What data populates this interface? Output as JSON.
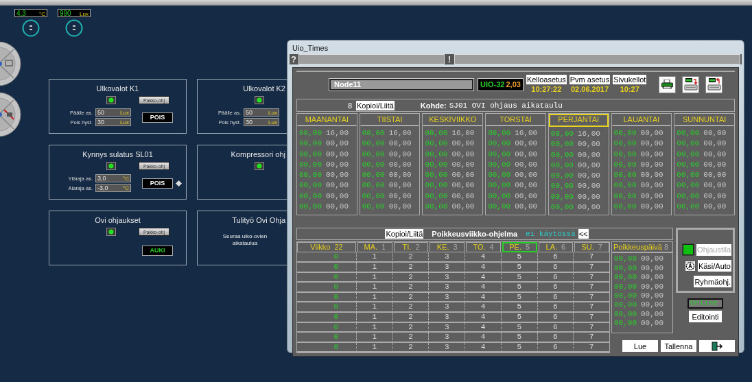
{
  "sensors": [
    {
      "value": "4,3",
      "unit": "°C"
    },
    {
      "value": "990",
      "unit": "Lux"
    }
  ],
  "panels": [
    {
      "title": "Ulkovalot K1",
      "indicator_on": true,
      "button": "Pakko-ohj",
      "rows": [
        {
          "label": "Päälle as.",
          "value": "50",
          "unit": "Lux"
        },
        {
          "label": "Pois hyst.",
          "value": "30",
          "unit": "Lux"
        }
      ],
      "status": "POIS",
      "status_on": false
    },
    {
      "title": "Ulkovalot K2",
      "indicator_on": true,
      "rows": [
        {
          "label": "Päälle as.",
          "value": "50",
          "unit": "Lux"
        },
        {
          "label": "Pois hyst.",
          "value": "30",
          "unit": "Lux"
        }
      ]
    },
    {
      "title": "Kynnys sulatus SL01",
      "indicator_on": true,
      "button": "Pakko-ohj",
      "rows": [
        {
          "label": "Yläraja as.",
          "value": "3,0",
          "unit": "°C"
        },
        {
          "label": "Alaraja as.",
          "value": "-3,0",
          "unit": "°C"
        }
      ],
      "status": "POIS",
      "status_on": false,
      "marker": true
    },
    {
      "title": "Kompressori ohj",
      "indicator_on": true
    },
    {
      "title": "Ovi ohjaukset",
      "indicator_on": true,
      "button": "Pakko-ohj",
      "status": "AUKI",
      "status_on": true
    },
    {
      "title": "Tulityö Ovi Ohja",
      "note": "Seuraa ulko-ovien aikataulua"
    }
  ],
  "dialog": {
    "title": "Uio_Times",
    "help_mark": "?",
    "alert_mark": "!",
    "node": "Node11",
    "version_name": "UIO-32",
    "version_number": "2,03",
    "clocks": [
      {
        "label": "Kelloasetus",
        "value": "10:27:22"
      },
      {
        "label": "Pvm asetus",
        "value": "02.06.2017"
      },
      {
        "label": "Sivukellot",
        "value": "10:27"
      }
    ],
    "program_number": "8",
    "copy_button": "Kopioi/Liitä",
    "target_label": "Kohde:",
    "target": "SJ01 OVI ohjaus aikataulu",
    "days": [
      {
        "name": "MAANANTAI",
        "selected": false,
        "times": [
          {
            "on": "08,00",
            "off": "16,00"
          },
          {
            "on": "00,00",
            "off": "00,00"
          },
          {
            "on": "00,00",
            "off": "00,00"
          },
          {
            "on": "00,00",
            "off": "00,00"
          },
          {
            "on": "00,00",
            "off": "00,00"
          },
          {
            "on": "00,00",
            "off": "00,00"
          },
          {
            "on": "00,00",
            "off": "00,00"
          },
          {
            "on": "00,00",
            "off": "00,00"
          }
        ]
      },
      {
        "name": "TIISTAI",
        "selected": false,
        "times": [
          {
            "on": "08,00",
            "off": "16,00"
          },
          {
            "on": "00,00",
            "off": "00,00"
          },
          {
            "on": "00,00",
            "off": "00,00"
          },
          {
            "on": "00,00",
            "off": "00,00"
          },
          {
            "on": "00,00",
            "off": "00,00"
          },
          {
            "on": "00,00",
            "off": "00,00"
          },
          {
            "on": "00,00",
            "off": "00,00"
          },
          {
            "on": "00,00",
            "off": "00,00"
          }
        ]
      },
      {
        "name": "KESKIVIIKKO",
        "selected": false,
        "times": [
          {
            "on": "08,00",
            "off": "16,00"
          },
          {
            "on": "00,00",
            "off": "00,00"
          },
          {
            "on": "00,00",
            "off": "00,00"
          },
          {
            "on": "00,00",
            "off": "00,00"
          },
          {
            "on": "00,00",
            "off": "00,00"
          },
          {
            "on": "00,00",
            "off": "00,00"
          },
          {
            "on": "00,00",
            "off": "00,00"
          },
          {
            "on": "00,00",
            "off": "00,00"
          }
        ]
      },
      {
        "name": "TORSTAI",
        "selected": false,
        "times": [
          {
            "on": "08,00",
            "off": "16,00"
          },
          {
            "on": "00,00",
            "off": "00,00"
          },
          {
            "on": "00,00",
            "off": "00,00"
          },
          {
            "on": "00,00",
            "off": "00,00"
          },
          {
            "on": "00,00",
            "off": "00,00"
          },
          {
            "on": "00,00",
            "off": "00,00"
          },
          {
            "on": "00,00",
            "off": "00,00"
          },
          {
            "on": "00,00",
            "off": "00,00"
          }
        ]
      },
      {
        "name": "PERJANTAI",
        "selected": true,
        "times": [
          {
            "on": "08,00",
            "off": "16,00"
          },
          {
            "on": "00,00",
            "off": "00,00"
          },
          {
            "on": "00,00",
            "off": "00,00"
          },
          {
            "on": "00,00",
            "off": "00,00"
          },
          {
            "on": "00,00",
            "off": "00,00"
          },
          {
            "on": "00,00",
            "off": "00,00"
          },
          {
            "on": "00,00",
            "off": "00,00"
          },
          {
            "on": "00,00",
            "off": "00,00"
          }
        ]
      },
      {
        "name": "LAUANTAI",
        "selected": false,
        "times": [
          {
            "on": "00,00",
            "off": "00,00"
          },
          {
            "on": "00,00",
            "off": "00,00"
          },
          {
            "on": "00,00",
            "off": "00,00"
          },
          {
            "on": "00,00",
            "off": "00,00"
          },
          {
            "on": "00,00",
            "off": "00,00"
          },
          {
            "on": "00,00",
            "off": "00,00"
          },
          {
            "on": "00,00",
            "off": "00,00"
          },
          {
            "on": "00,00",
            "off": "00,00"
          }
        ]
      },
      {
        "name": "SUNNUNTAI",
        "selected": false,
        "times": [
          {
            "on": "00,00",
            "off": "00,00"
          },
          {
            "on": "00,00",
            "off": "00,00"
          },
          {
            "on": "00,00",
            "off": "00,00"
          },
          {
            "on": "00,00",
            "off": "00,00"
          },
          {
            "on": "00,00",
            "off": "00,00"
          },
          {
            "on": "00,00",
            "off": "00,00"
          },
          {
            "on": "00,00",
            "off": "00,00"
          },
          {
            "on": "00,00",
            "off": "00,00"
          }
        ]
      }
    ],
    "exception": {
      "copy_button": "Kopioi/Liitä",
      "title": "Poikkeusviikko-ohjelma",
      "status": "ei käytössä",
      "collapse_button": "<<",
      "week_label": "Viikko",
      "week": "22",
      "columns": [
        {
          "abbr": "MA.",
          "number": "1",
          "selected": false
        },
        {
          "abbr": "TI.",
          "number": "2",
          "selected": false
        },
        {
          "abbr": "KE.",
          "number": "3",
          "selected": false
        },
        {
          "abbr": "TO.",
          "number": "4",
          "selected": false
        },
        {
          "abbr": "PE.",
          "number": "5",
          "selected": true
        },
        {
          "abbr": "LA.",
          "number": "6",
          "selected": false
        },
        {
          "abbr": "SU.",
          "number": "7",
          "selected": false
        }
      ],
      "rows": [
        {
          "week": "0",
          "days": [
            "1",
            "2",
            "3",
            "4",
            "5",
            "6",
            "7"
          ]
        },
        {
          "week": "0",
          "days": [
            "1",
            "2",
            "3",
            "4",
            "5",
            "6",
            "7"
          ]
        },
        {
          "week": "0",
          "days": [
            "1",
            "2",
            "3",
            "4",
            "5",
            "6",
            "7"
          ]
        },
        {
          "week": "0",
          "days": [
            "1",
            "2",
            "3",
            "4",
            "5",
            "6",
            "7"
          ]
        },
        {
          "week": "0",
          "days": [
            "1",
            "2",
            "3",
            "4",
            "5",
            "6",
            "7"
          ]
        },
        {
          "week": "0",
          "days": [
            "1",
            "2",
            "3",
            "4",
            "5",
            "6",
            "7"
          ]
        },
        {
          "week": "0",
          "days": [
            "1",
            "2",
            "3",
            "4",
            "5",
            "6",
            "7"
          ]
        },
        {
          "week": "0",
          "days": [
            "1",
            "2",
            "3",
            "4",
            "5",
            "6",
            "7"
          ]
        },
        {
          "week": "0",
          "days": [
            "1",
            "2",
            "3",
            "4",
            "5",
            "6",
            "7"
          ]
        },
        {
          "week": "0",
          "days": [
            "1",
            "2",
            "3",
            "4",
            "5",
            "6",
            "7"
          ]
        }
      ]
    },
    "exception_day": {
      "label": "Poikkeuspäivä",
      "number": "8",
      "times": [
        {
          "on": "00,00",
          "off": "00,00"
        },
        {
          "on": "00,00",
          "off": "00,00"
        },
        {
          "on": "00,00",
          "off": "00,00"
        },
        {
          "on": "00,00",
          "off": "00,00"
        },
        {
          "on": "00,00",
          "off": "00,00"
        },
        {
          "on": "00,00",
          "off": "00,00"
        },
        {
          "on": "00,00",
          "off": "00,00"
        },
        {
          "on": "00,00",
          "off": "00,00"
        }
      ]
    },
    "mode_buttons": [
      {
        "kind": "indicator",
        "label": "Ohjaustila",
        "disabled": true,
        "on": true
      },
      {
        "kind": "auto",
        "label": "Käsi/Auto",
        "disabled": false
      },
      {
        "kind": "plain",
        "label": "Ryhmäohj.",
        "disabled": false
      }
    ],
    "online": "Online",
    "edit_button": "Editointi",
    "actions": [
      "Lue",
      "Tallenna"
    ]
  }
}
